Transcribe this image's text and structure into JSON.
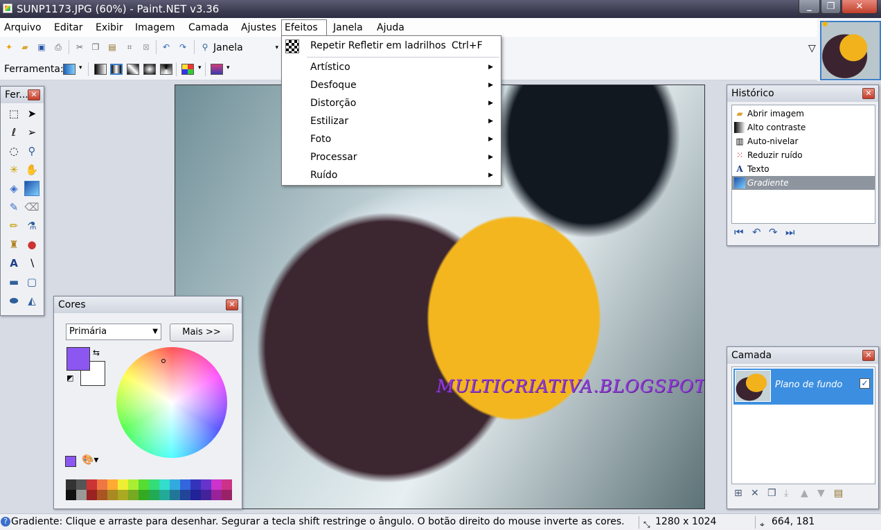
{
  "window": {
    "title": "SUNP1173.JPG (60%) - Paint.NET v3.36"
  },
  "menubar": {
    "items": [
      {
        "label": "Arquivo"
      },
      {
        "label": "Editar"
      },
      {
        "label": "Exibir"
      },
      {
        "label": "Imagem"
      },
      {
        "label": "Camada"
      },
      {
        "label": "Ajustes"
      },
      {
        "label": "Efeitos"
      },
      {
        "label": "Janela"
      },
      {
        "label": "Ajuda"
      }
    ]
  },
  "toolbar": {
    "zoom_label": "Janela",
    "tool_label": "Ferramenta:"
  },
  "effects_menu": {
    "repeat": {
      "label": "Repetir Refletir em ladrilhos",
      "shortcut": "Ctrl+F"
    },
    "items": [
      {
        "label": "Artístico"
      },
      {
        "label": "Desfoque"
      },
      {
        "label": "Distorção"
      },
      {
        "label": "Estilizar"
      },
      {
        "label": "Foto"
      },
      {
        "label": "Processar"
      },
      {
        "label": "Ruído"
      }
    ]
  },
  "tools_panel": {
    "title": "Fer..."
  },
  "colors_panel": {
    "title": "Cores",
    "mode_select": "Primária",
    "more_button": "Mais >>",
    "primary_color": "#8c57f0",
    "secondary_color": "#ffffff"
  },
  "history_panel": {
    "title": "Histórico",
    "items": [
      {
        "label": "Abrir imagem",
        "icon": "folder-icon"
      },
      {
        "label": "Alto contraste",
        "icon": "contrast-icon"
      },
      {
        "label": "Auto-nivelar",
        "icon": "levels-icon"
      },
      {
        "label": "Reduzir ruído",
        "icon": "noise-icon"
      },
      {
        "label": "Texto",
        "icon": "text-icon"
      },
      {
        "label": "Gradiente",
        "icon": "gradient-icon"
      }
    ]
  },
  "layers_panel": {
    "title": "Camada",
    "layer_name": "Plano de fundo"
  },
  "canvas": {
    "watermark": "MULTICRIATIVA.BLOGSPOT.COM"
  },
  "statusbar": {
    "message": "Gradiente: Clique e arraste para desenhar. Segurar a tecla shift restringe o ângulo. O botão direito do mouse inverte as cores.",
    "image_size": "1280 x 1024",
    "cursor_position": "664, 181"
  },
  "colors": {
    "accent": "#3c8fe0",
    "close_red": "#c43f2b"
  }
}
